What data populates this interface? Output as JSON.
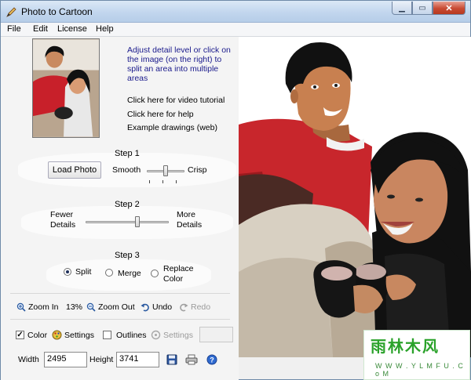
{
  "window": {
    "title": "Photo to Cartoon"
  },
  "menu": [
    "File",
    "Edit",
    "License",
    "Help"
  ],
  "intro": "Adjust detail level or click on the image (on the right) to split an area into multiple areas",
  "links": {
    "video": "Click here for video tutorial",
    "help": "Click here for help",
    "examples": "Example drawings (web)"
  },
  "step1": {
    "title": "Step 1",
    "load": "Load Photo",
    "left": "Smooth",
    "right": "Crisp"
  },
  "step2": {
    "title": "Step 2",
    "left": "Fewer\nDetails",
    "right": "More\nDetails"
  },
  "step3": {
    "title": "Step 3",
    "split": "Split",
    "merge": "Merge",
    "replace": "Replace\nColor",
    "selected": "Split"
  },
  "zoom": {
    "zoom_in": "Zoom In",
    "level": "13%",
    "zoom_out": "Zoom Out",
    "undo": "Undo",
    "redo": "Redo"
  },
  "options": {
    "color": "Color",
    "settings": "Settings",
    "outlines": "Outlines",
    "outline_settings": "Settings",
    "color_checked": true,
    "outlines_checked": false
  },
  "size": {
    "width_label": "Width",
    "width": "2495",
    "height_label": "Height",
    "height": "3741"
  },
  "watermark": {
    "text": "雨林木风",
    "url": "W W W . Y L M F U . C o M"
  },
  "sliders": {
    "smooth_crisp": 0.5,
    "details": 0.62
  }
}
